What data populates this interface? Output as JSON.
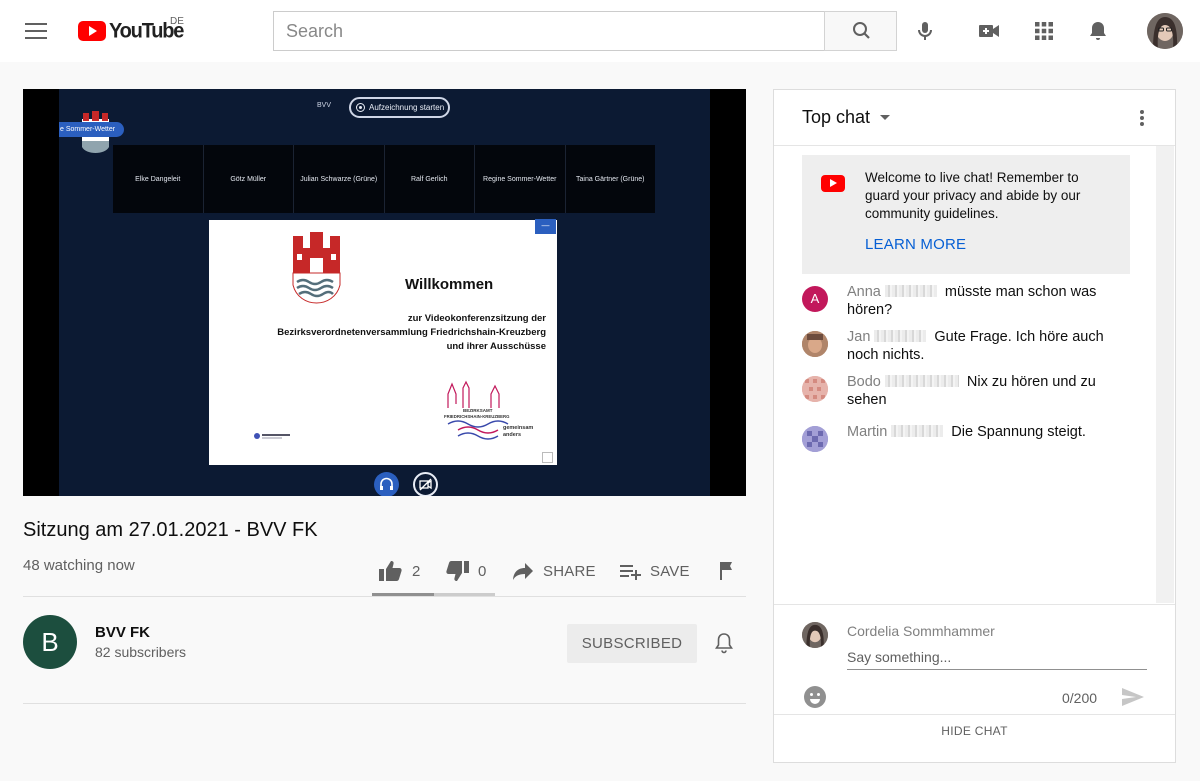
{
  "masthead": {
    "logo_text": "YouTube",
    "country_code": "DE",
    "search_placeholder": "Search",
    "icons": [
      "menu-icon",
      "search-icon",
      "mic-icon",
      "create-video-icon",
      "apps-icon",
      "notifications-icon"
    ]
  },
  "video": {
    "conference": {
      "room_label": "BVV",
      "record_label": "Aufzeichnung starten",
      "speaker_label": "e Sommer-Wetter",
      "participants": [
        "Elke Dangeleit",
        "Götz Müller",
        "Julian Schwarze (Grüne)",
        "Ralf Gerlich",
        "Regine Sommer-Wetter",
        "Taina Gärtner (Grüne)"
      ],
      "slide": {
        "heading": "Willkommen",
        "lines": [
          "zur Videokonferenzsitzung der",
          "Bezirksverordnetenversammlung Friedrichshain-Kreuzberg",
          "und ihrer Ausschüsse"
        ],
        "logo_top": "BEZIRKSAMT",
        "logo_mid": "FRIEDRICHSHAIN-KREUZBERG",
        "logo_tag1": "gemeinsam",
        "logo_tag2": "anders",
        "button": "—"
      }
    },
    "title": "Sitzung am 27.01.2021 - BVV FK",
    "watching": "48 watching now",
    "likes": "2",
    "dislikes": "0",
    "share_label": "SHARE",
    "save_label": "SAVE",
    "sentiment_like_fraction": 0.5
  },
  "owner": {
    "initial": "B",
    "name": "BVV FK",
    "subscribers": "82 subscribers",
    "subscribe_label": "SUBSCRIBED",
    "avatar_color": "#1c4e3e"
  },
  "chat": {
    "mode_label": "Top chat",
    "welcome_text": "Welcome to live chat! Remember to guard your privacy and abide by our community guidelines.",
    "learn_more": "LEARN MORE",
    "messages": [
      {
        "author": "Anna",
        "text": "müsste man schon was hören?",
        "avatar_initial": "A"
      },
      {
        "author": "Jan",
        "text": "Gute Frage. Ich höre auch noch nichts."
      },
      {
        "author": "Bodo",
        "text": "Nix zu hören und zu sehen"
      },
      {
        "author": "Martin",
        "text": "Die Spannung steigt."
      }
    ],
    "me_name": "Cordelia Sommhammer",
    "input_placeholder": "Say something...",
    "char_count": "0/200",
    "hide_label": "HIDE CHAT"
  },
  "colors": {
    "brand_red": "#ff0000",
    "link_blue": "#065fd4",
    "conference_blue": "#2b5fbf"
  }
}
